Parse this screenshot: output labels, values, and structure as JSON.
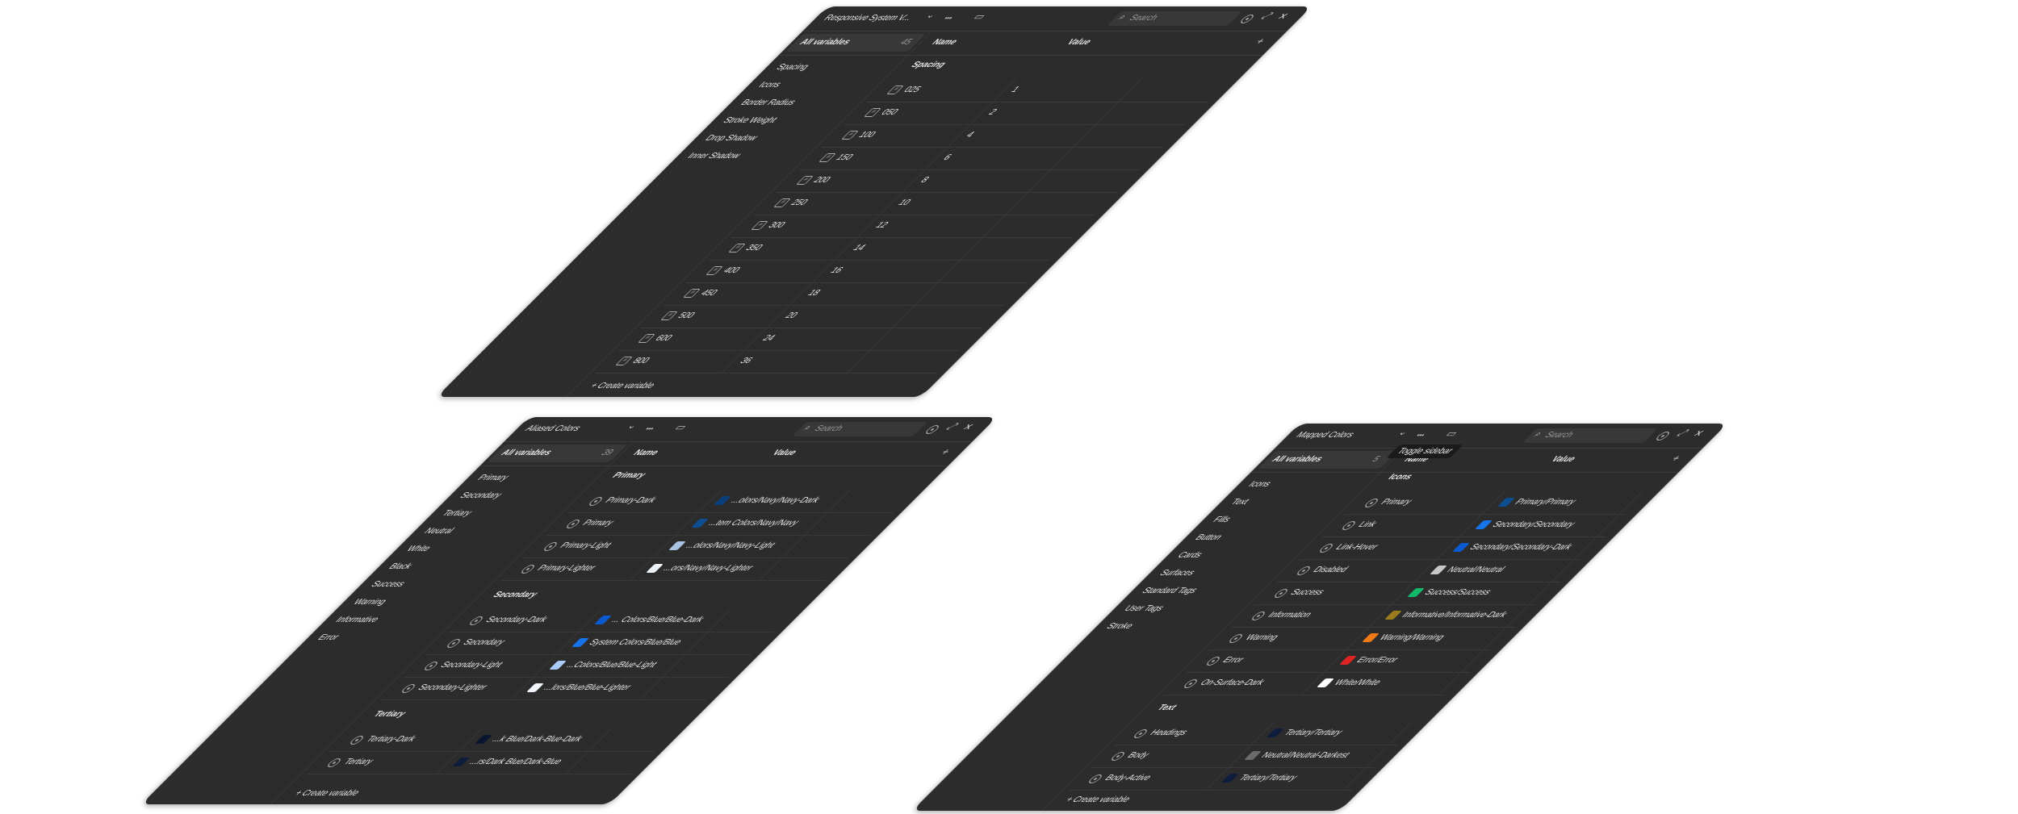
{
  "panels": [
    {
      "id": "responsive",
      "collection": "Responsive System V...",
      "search_placeholder": "Search",
      "all_variables": "All variables",
      "count": "45",
      "col_name": "Name",
      "col_value": "Value",
      "sidebar": [
        "Spacing",
        "Icons",
        "Border Radius",
        "Stroke Weight",
        "Drop Shadow",
        "Inner Shadow"
      ],
      "groups": [
        {
          "title": "Spacing",
          "rows": [
            {
              "name": "025",
              "value": "1"
            },
            {
              "name": "050",
              "value": "2"
            },
            {
              "name": "100",
              "value": "4"
            },
            {
              "name": "150",
              "value": "6"
            },
            {
              "name": "200",
              "value": "8"
            },
            {
              "name": "250",
              "value": "10"
            },
            {
              "name": "300",
              "value": "12"
            },
            {
              "name": "350",
              "value": "14"
            },
            {
              "name": "400",
              "value": "16"
            },
            {
              "name": "450",
              "value": "18"
            },
            {
              "name": "500",
              "value": "20"
            },
            {
              "name": "600",
              "value": "24"
            },
            {
              "name": "800",
              "value": "36"
            }
          ]
        }
      ],
      "create_label": "Create variable"
    },
    {
      "id": "aliased",
      "collection": "Aliased Colors",
      "search_placeholder": "Search",
      "all_variables": "All variables",
      "count": "39",
      "col_name": "Name",
      "col_value": "Value",
      "sidebar": [
        "Primary",
        "Secondary",
        "Tertiary",
        "Neutral",
        "White",
        "Black",
        "Success",
        "Warning",
        "Informative",
        "Error"
      ],
      "groups": [
        {
          "title": "Primary",
          "rows": [
            {
              "name": "Primary-Dark",
              "value": "...olors/Navy/Navy-Dark",
              "color": "#0b3f7a"
            },
            {
              "name": "Primary",
              "value": "...tem Colors/Navy/Navy",
              "color": "#0e4d92"
            },
            {
              "name": "Primary-Light",
              "value": "...olors/Navy/Navy-Light",
              "color": "#a8c4e2"
            },
            {
              "name": "Primary-Lighter",
              "value": "...ors/Navy/Navy-Lighter",
              "color": "#eef3f8"
            }
          ]
        },
        {
          "title": "Secondary",
          "rows": [
            {
              "name": "Secondary-Dark",
              "value": "... Colors/Blue/Blue-Dark",
              "color": "#0a5ad1"
            },
            {
              "name": "Secondary",
              "value": "System Colors/Blue/Blue",
              "color": "#1673ea"
            },
            {
              "name": "Secondary-Light",
              "value": "...Colors/Blue/Blue-Light",
              "color": "#a9cbf5"
            },
            {
              "name": "Secondary-Lighter",
              "value": "...lors/Blue/Blue-Lighter",
              "color": "#f1f5fb"
            }
          ]
        },
        {
          "title": "Tertiary",
          "rows": [
            {
              "name": "Tertiary-Dark",
              "value": "...k Blue/Dark-Blue-Dark",
              "color": "#0a1530"
            },
            {
              "name": "Tertiary",
              "value": "...rs/Dark Blue/Dark-Blue",
              "color": "#0f1d3d"
            }
          ]
        }
      ],
      "create_label": "Create variable"
    },
    {
      "id": "mapped",
      "collection": "Mapped Colors",
      "search_placeholder": "Search",
      "all_variables": "All variables",
      "count": "5",
      "col_name": "Name",
      "col_value": "Value",
      "tooltip": "Toggle sidebar",
      "sidebar": [
        "Icons",
        "Text",
        "Fills",
        "Button",
        "Cards",
        "Surfaces",
        "Standard Tags",
        "User Tags",
        "Stroke"
      ],
      "groups": [
        {
          "title": "Icons",
          "rows": [
            {
              "name": "Primary",
              "value": "Primary/Primary",
              "color": "#0e4d92"
            },
            {
              "name": "Link",
              "value": "Secondary/Secondary",
              "color": "#1673ea"
            },
            {
              "name": "Link-Hover",
              "value": "Secondary/Secondary-Dark",
              "color": "#0a5ad1"
            },
            {
              "name": "Disabled",
              "value": "Neutral/Neutral",
              "color": "#c8c8c8"
            },
            {
              "name": "Success",
              "value": "Success/Success",
              "color": "#12b76a"
            },
            {
              "name": "Information",
              "value": "Informative/Informative-Dark",
              "color": "#9a7b1e"
            },
            {
              "name": "Warning",
              "value": "Warning/Warning",
              "color": "#f07a13"
            },
            {
              "name": "Error",
              "value": "Error/Error",
              "color": "#e02424"
            },
            {
              "name": "On-Surface-Dark",
              "value": "White/White",
              "color": "#ffffff"
            }
          ]
        },
        {
          "title": "Text",
          "rows": [
            {
              "name": "Headings",
              "value": "Tertiary/Tertiary",
              "color": "#0f1d3d"
            },
            {
              "name": "Body",
              "value": "Neutral/Neutral-Darkest",
              "color": "#6b6b6b"
            },
            {
              "name": "Body-Active",
              "value": "Tertiary/Tertiary",
              "color": "#0f1d3d"
            }
          ]
        }
      ],
      "create_label": "Create variable"
    }
  ]
}
